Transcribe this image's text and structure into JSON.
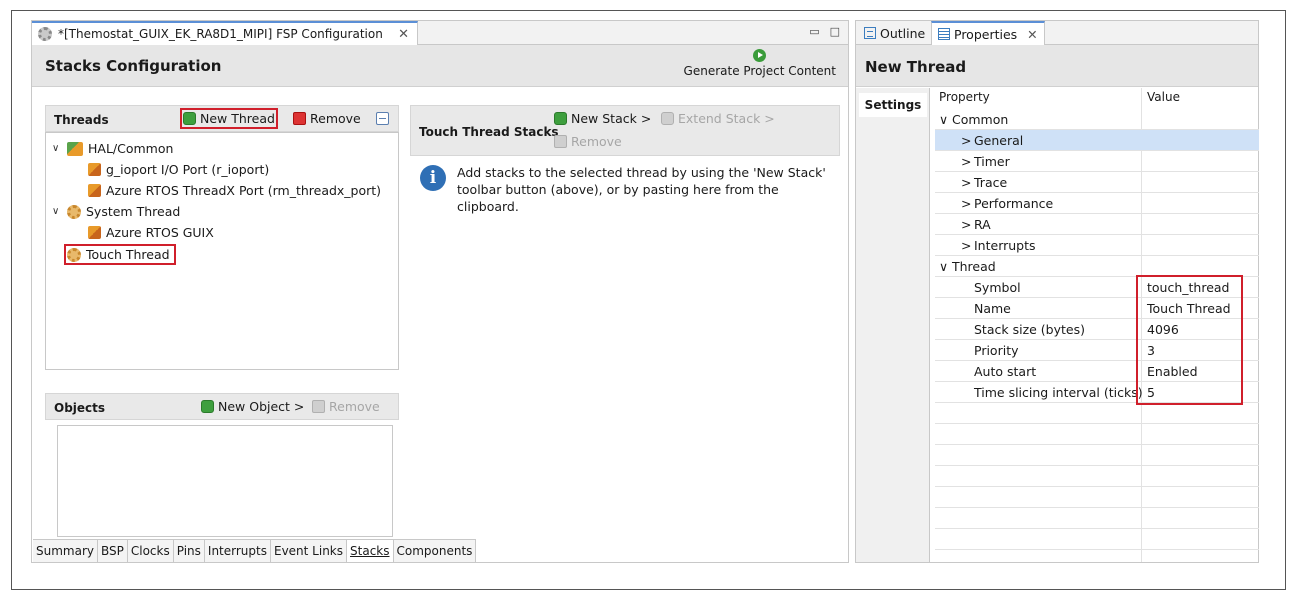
{
  "editor": {
    "tab_title": "*[Themostat_GUIX_EK_RA8D1_MIPI] FSP Configuration",
    "tab_close": "✕",
    "minimize": "▭",
    "maximize": "□",
    "page_title": "Stacks Configuration",
    "generate_label": "Generate Project Content"
  },
  "threads": {
    "title": "Threads",
    "new_thread": "New Thread",
    "remove": "Remove",
    "tree": [
      {
        "label": "HAL/Common",
        "chevron": "∨"
      },
      {
        "label": "g_ioport I/O Port (r_ioport)"
      },
      {
        "label": "Azure RTOS ThreadX Port (rm_threadx_port)"
      },
      {
        "label": "System Thread",
        "chevron": "∨"
      },
      {
        "label": "Azure RTOS GUIX"
      },
      {
        "label": "Touch Thread"
      }
    ]
  },
  "objects": {
    "title": "Objects",
    "new_object": "New Object >",
    "remove": "Remove"
  },
  "stacks": {
    "title": "Touch Thread Stacks",
    "new_stack": "New Stack >",
    "extend_stack": "Extend Stack >",
    "remove": "Remove",
    "info": "Add stacks to the selected thread by using the 'New Stack' toolbar button (above), or by pasting here from the clipboard."
  },
  "bottom_tabs": [
    "Summary",
    "BSP",
    "Clocks",
    "Pins",
    "Interrupts",
    "Event Links",
    "Stacks",
    "Components"
  ],
  "bottom_active": "Stacks",
  "right": {
    "outline_tab": "Outline",
    "properties_tab": "Properties",
    "tab_close": "✕",
    "title": "New Thread",
    "settings_tab": "Settings",
    "col_property": "Property",
    "col_value": "Value",
    "rows": [
      {
        "name": "Common",
        "chevron": "∨",
        "value": ""
      },
      {
        "name": "General",
        "chevron": ">",
        "value": ""
      },
      {
        "name": "Timer",
        "chevron": ">",
        "value": ""
      },
      {
        "name": "Trace",
        "chevron": ">",
        "value": ""
      },
      {
        "name": "Performance",
        "chevron": ">",
        "value": ""
      },
      {
        "name": "RA",
        "chevron": ">",
        "value": ""
      },
      {
        "name": "Interrupts",
        "chevron": ">",
        "value": ""
      },
      {
        "name": "Thread",
        "chevron": "∨",
        "value": ""
      },
      {
        "name": "Symbol",
        "chevron": "",
        "value": "touch_thread"
      },
      {
        "name": "Name",
        "chevron": "",
        "value": "Touch Thread"
      },
      {
        "name": "Stack size (bytes)",
        "chevron": "",
        "value": "4096"
      },
      {
        "name": "Priority",
        "chevron": "",
        "value": "3"
      },
      {
        "name": "Auto start",
        "chevron": "",
        "value": "Enabled"
      },
      {
        "name": "Time slicing interval (ticks)",
        "chevron": "",
        "value": "5"
      }
    ]
  },
  "colors": {
    "highlight_box": "#d01f2b",
    "selection": "#cfe1f7",
    "active_tab": "#5b8fd6"
  }
}
